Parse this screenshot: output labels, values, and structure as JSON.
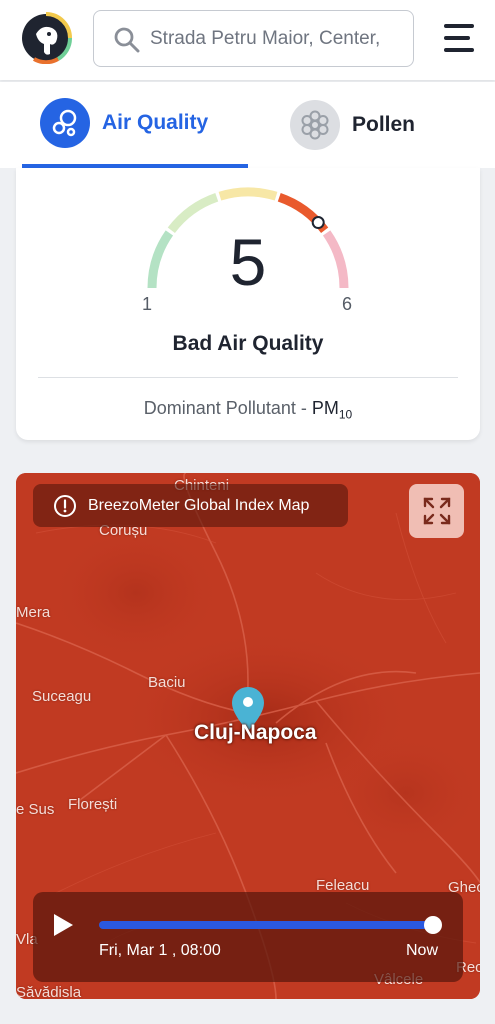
{
  "header": {
    "logo_icon": "elephant-logo-icon",
    "search": {
      "value": "Strada Petru Maior, Center,",
      "icon": "search-icon"
    },
    "menu_icon": "hamburger-menu-icon"
  },
  "tabs": [
    {
      "label": "Air Quality",
      "icon": "air-bubbles-icon",
      "active": true
    },
    {
      "label": "Pollen",
      "icon": "pollen-flower-icon",
      "active": false
    }
  ],
  "gauge": {
    "value": "5",
    "min_label": "1",
    "max_label": "6",
    "status": "Bad Air Quality",
    "dominant_prefix": "Dominant Pollutant - ",
    "pollutant": "PM",
    "pollutant_sub": "10",
    "level_fraction": 0.8,
    "colors": [
      "#b4e2c4",
      "#d8ecc4",
      "#f7e7a6",
      "#e95a2d",
      "#f4b9c6"
    ]
  },
  "map": {
    "title": "BreezoMeter Global Index Map",
    "info_icon": "info-circle-icon",
    "expand_icon": "expand-icon",
    "city": "Cluj-Napoca",
    "places": [
      "Chinteni",
      "Corușu",
      "Mera",
      "Suceagu",
      "Baciu",
      "Florești",
      "e Sus",
      "Feleacu",
      "Ghec",
      "Vla",
      "Săvădisla",
      "Vâlcele",
      "Rec"
    ],
    "pin_icon": "location-pin-icon",
    "player": {
      "play_icon": "play-icon",
      "time": "Fri, Mar 1 , 08:00",
      "end_label": "Now",
      "progress": 1.0
    }
  }
}
